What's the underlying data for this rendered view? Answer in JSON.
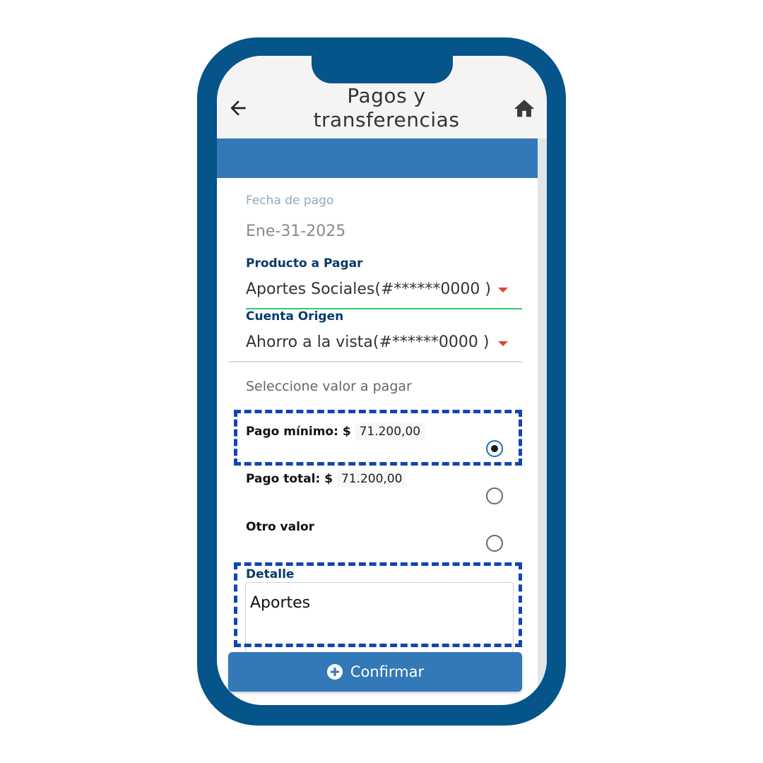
{
  "header": {
    "title": "Pagos y transferencias"
  },
  "form": {
    "fecha_label": "Fecha de pago",
    "fecha_value": "Ene-31-2025",
    "producto_label": "Producto a Pagar",
    "producto_value": "Aportes Sociales(#******0000 )",
    "cuenta_label": "Cuenta Origen",
    "cuenta_value": "Ahorro a la vista(#******0000 )",
    "seleccione": "Seleccione valor a pagar",
    "options": [
      {
        "label": "Pago mínimo: $",
        "amount": "71.200,00",
        "selected": true
      },
      {
        "label": "Pago total: $",
        "amount": "71.200,00",
        "selected": false
      },
      {
        "label": "Otro valor",
        "amount": "",
        "selected": false
      }
    ],
    "detalle_label": "Detalle",
    "detalle_value": "Aportes"
  },
  "button": {
    "label": "Confirmar"
  },
  "colors": {
    "frame": "#05548a",
    "accent": "#3379b7",
    "label": "#063b6b",
    "caret": "#d94a2a",
    "highlight": "#1245b3",
    "active_line": "#2ecc71"
  },
  "icons": {
    "back": "arrow-left-icon",
    "home": "home-icon",
    "caret": "caret-down-icon",
    "plus": "plus-circle-icon"
  }
}
